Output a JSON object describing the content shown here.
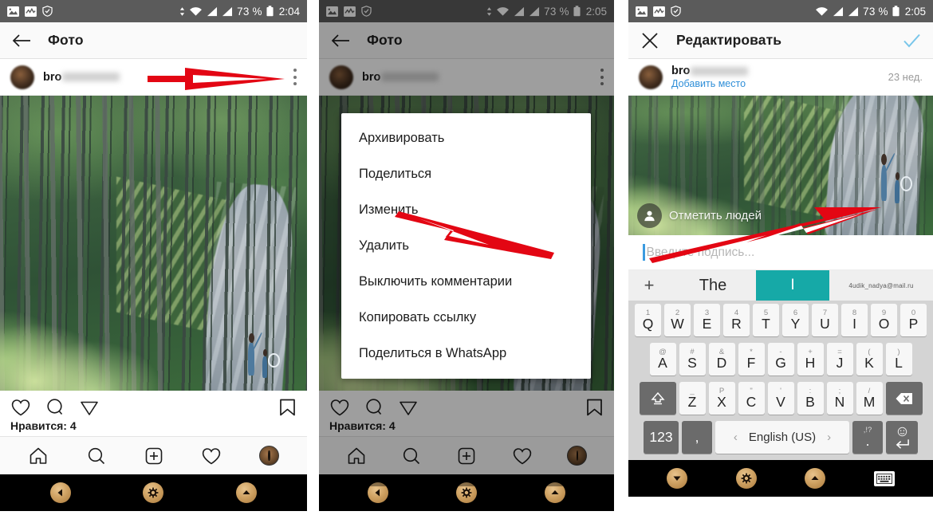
{
  "panels": [
    {
      "id": "panel-post-view",
      "status": {
        "battery": "73 %",
        "time": "2:04",
        "icons": [
          "image-icon",
          "activity-icon",
          "shield-icon",
          "download-icon",
          "wifi-icon",
          "signal-icon",
          "signal2-icon",
          "battery-icon"
        ]
      },
      "appbar": {
        "back_icon": "back-arrow-icon",
        "title": "Фото",
        "kebab_icon": "overflow-menu-icon"
      },
      "user": {
        "name_prefix": "bro",
        "avatar": "user-avatar"
      },
      "actions": {
        "like": "heart-icon",
        "comment": "comment-icon",
        "share": "send-icon",
        "save": "bookmark-icon"
      },
      "likes_text": "Нравится: 4",
      "tabs": [
        "home-icon",
        "search-icon",
        "add-icon",
        "heart-icon",
        "profile-avatar"
      ],
      "sysnav": [
        "back-button",
        "home-button",
        "recents-button"
      ]
    },
    {
      "id": "panel-context-menu",
      "status": {
        "battery": "73 %",
        "time": "2:05"
      },
      "appbar": {
        "back_icon": "back-arrow-icon",
        "title": "Фото",
        "kebab_icon": "overflow-menu-icon"
      },
      "user": {
        "name_prefix": "bro"
      },
      "menu_items": [
        "Архивировать",
        "Поделиться",
        "Изменить",
        "Удалить",
        "Выключить комментарии",
        "Копировать ссылку",
        "Поделиться в WhatsApp"
      ],
      "likes_text": "Нравится: 4"
    },
    {
      "id": "panel-edit",
      "status": {
        "battery": "73 %",
        "time": "2:05"
      },
      "appbar": {
        "close_icon": "close-icon",
        "title": "Редактировать",
        "confirm_icon": "check-icon"
      },
      "user": {
        "name_prefix": "bro",
        "add_location": "Добавить место",
        "age": "23 нед."
      },
      "photo_overlay": {
        "tag_people": "Отметить людей",
        "tag_icon": "person-tag-icon"
      },
      "caption": {
        "placeholder": "Введите подпись..."
      },
      "keyboard": {
        "suggestions": {
          "plus": "+",
          "word1": "The",
          "word2": "I",
          "word3": "4udik_nadya@mail.ru"
        },
        "row1": [
          {
            "sup": "1",
            "main": "Q"
          },
          {
            "sup": "2",
            "main": "W"
          },
          {
            "sup": "3",
            "main": "E"
          },
          {
            "sup": "4",
            "main": "R"
          },
          {
            "sup": "5",
            "main": "T"
          },
          {
            "sup": "6",
            "main": "Y"
          },
          {
            "sup": "7",
            "main": "U"
          },
          {
            "sup": "8",
            "main": "I"
          },
          {
            "sup": "9",
            "main": "O"
          },
          {
            "sup": "0",
            "main": "P"
          }
        ],
        "row2": [
          {
            "sup": "@",
            "main": "A"
          },
          {
            "sup": "#",
            "main": "S"
          },
          {
            "sup": "&",
            "main": "D"
          },
          {
            "sup": "*",
            "main": "F"
          },
          {
            "sup": "-",
            "main": "G"
          },
          {
            "sup": "+",
            "main": "H"
          },
          {
            "sup": "=",
            "main": "J"
          },
          {
            "sup": "(",
            "main": "K"
          },
          {
            "sup": ")",
            "main": "L"
          }
        ],
        "row3": [
          {
            "sup": "_",
            "main": "Z"
          },
          {
            "sup": "Р",
            "main": "X"
          },
          {
            "sup": "\"",
            "main": "C"
          },
          {
            "sup": "'",
            "main": "V"
          },
          {
            "sup": ":",
            "main": "B"
          },
          {
            "sup": ";",
            "main": "N"
          },
          {
            "sup": "/",
            "main": "M"
          }
        ],
        "shift_icon": "shift-icon",
        "backspace_icon": "backspace-icon",
        "row4": {
          "numbers": "123",
          "comma": ",",
          "prev": "‹",
          "language": "English (US)",
          "next": "›",
          "dot_sup": ",!?",
          "dot_main": ".",
          "enter_sup": "emoji-icon",
          "enter_main": "enter-icon"
        }
      },
      "sysnav": [
        "back-button",
        "home-button",
        "recents-button",
        "keyboard-toggle"
      ]
    }
  ],
  "theme": {
    "status_bar_bg": "#5b5b5b",
    "appbar_bg": "#fafafa",
    "accent_blue": "#2f8fd8",
    "suggestion_teal": "#16a9a7",
    "annotation_red": "#e30613",
    "key_light": "#f7f7f7",
    "key_dark": "#6b6b6b",
    "keyboard_bg": "#d4d4d4"
  }
}
